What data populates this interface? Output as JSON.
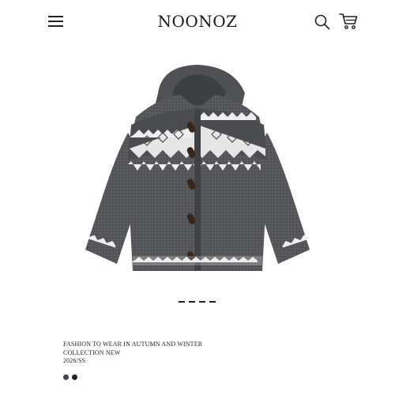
{
  "header": {
    "logo": "NOONOZ",
    "menu_icon": "hamburger-menu-icon",
    "search_icon": "search-icon",
    "cart_icon": "shopping-cart-icon"
  },
  "product": {
    "image_alt": "Gray hooded knit cardigan with white Fair Isle pattern and toggle buttons",
    "description_line1": "FASHION TO WEAR IN AUTUMN AND WINTER",
    "description_line2": "COLLECTION NEW",
    "season": "2026/SS",
    "swatches": [
      {
        "name": "charcoal",
        "color": "#3f4450"
      },
      {
        "name": "navy",
        "color": "#1b2233"
      }
    ]
  },
  "carousel": {
    "count": 4,
    "active": 0
  },
  "colors": {
    "sweater": "#56585b",
    "pattern": "#f1f1f1",
    "button": "#3a2618"
  }
}
